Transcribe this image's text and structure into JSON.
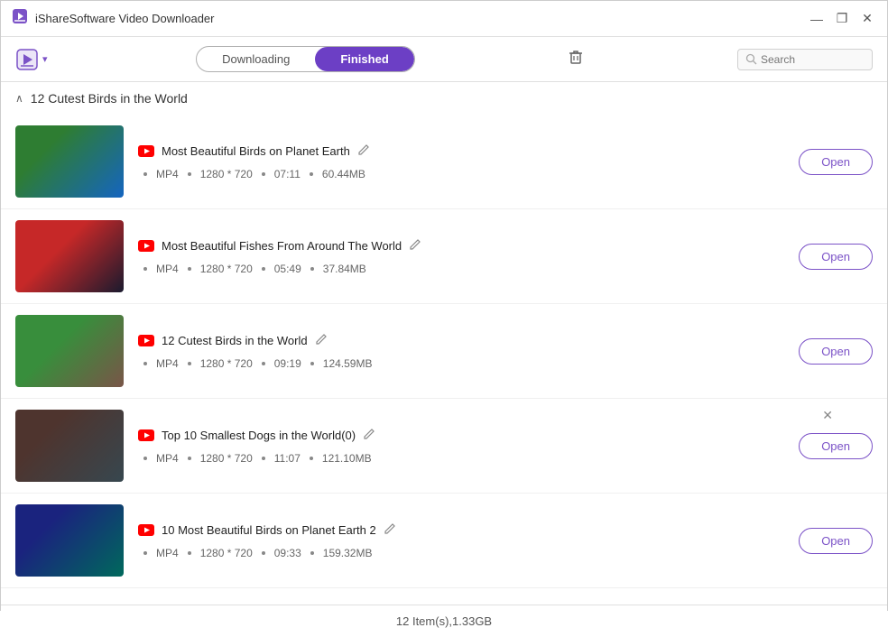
{
  "app": {
    "title": "iShareSoftware Video Downloader",
    "icon": "📥"
  },
  "title_controls": {
    "minimize": "—",
    "maximize": "□",
    "restore": "❐",
    "close": "✕"
  },
  "toolbar": {
    "add_btn_label": "📥",
    "dropdown_arrow": "▾",
    "delete_icon": "🗑",
    "search_placeholder": "Search"
  },
  "tabs": {
    "downloading": "Downloading",
    "finished": "Finished",
    "active": "finished"
  },
  "group": {
    "title": "12 Cutest Birds in the World",
    "collapsed": false,
    "collapse_icon": "∧"
  },
  "videos": [
    {
      "id": 1,
      "title": "Most Beautiful Birds on Planet Earth",
      "format": "MP4",
      "resolution": "1280 * 720",
      "duration": "07:11",
      "size": "60.44MB",
      "thumb_class": "thumb-1",
      "has_close": false
    },
    {
      "id": 2,
      "title": "Most Beautiful Fishes From Around The World",
      "format": "MP4",
      "resolution": "1280 * 720",
      "duration": "05:49",
      "size": "37.84MB",
      "thumb_class": "thumb-2",
      "has_close": false
    },
    {
      "id": 3,
      "title": "12 Cutest Birds in the World",
      "format": "MP4",
      "resolution": "1280 * 720",
      "duration": "09:19",
      "size": "124.59MB",
      "thumb_class": "thumb-3",
      "has_close": false
    },
    {
      "id": 4,
      "title": "Top 10 Smallest Dogs in the World(0)",
      "format": "MP4",
      "resolution": "1280 * 720",
      "duration": "11:07",
      "size": "121.10MB",
      "thumb_class": "thumb-4",
      "has_close": true
    },
    {
      "id": 5,
      "title": "10 Most Beautiful Birds on Planet Earth 2",
      "format": "MP4",
      "resolution": "1280 * 720",
      "duration": "09:33",
      "size": "159.32MB",
      "thumb_class": "thumb-5",
      "has_close": false
    }
  ],
  "footer": {
    "summary": "12 Item(s),1.33GB"
  },
  "buttons": {
    "open": "Open",
    "close": "×"
  }
}
